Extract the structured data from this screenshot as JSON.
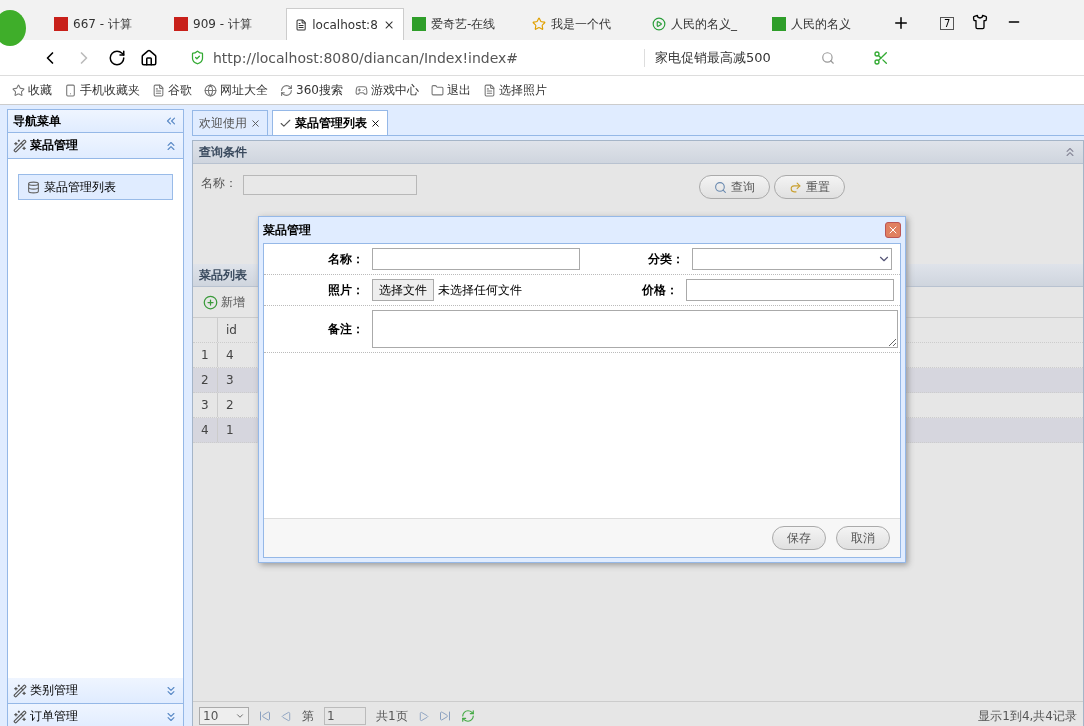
{
  "browser": {
    "tabs": [
      {
        "title": "667 - 计算",
        "selected": false,
        "kind": "red"
      },
      {
        "title": "909 - 计算",
        "selected": false,
        "kind": "red"
      },
      {
        "title": "localhost:8",
        "selected": true,
        "kind": "page"
      },
      {
        "title": "爱奇艺-在线",
        "selected": false,
        "kind": "green"
      },
      {
        "title": "我是一个代",
        "selected": false,
        "kind": "star"
      },
      {
        "title": "人民的名义_",
        "selected": false,
        "kind": "play"
      },
      {
        "title": "人民的名义",
        "selected": false,
        "kind": "green"
      }
    ],
    "tab_count": "7",
    "url_host": "http://localhost",
    "url_rest": ":8080/diancan/Index!index#",
    "search": "家电促销最高减500",
    "bookmarks": [
      "收藏",
      "手机收藏夹",
      "谷歌",
      "网址大全",
      "360搜索",
      "游戏中心",
      "退出",
      "选择照片"
    ]
  },
  "sidebar": {
    "title": "导航菜单",
    "panels": [
      {
        "title": "菜品管理",
        "expanded": true,
        "items": [
          {
            "label": "菜品管理列表",
            "selected": true
          }
        ]
      },
      {
        "title": "类别管理",
        "expanded": false
      },
      {
        "title": "订单管理",
        "expanded": false
      }
    ]
  },
  "content_tabs": [
    {
      "label": "欢迎使用",
      "selected": false
    },
    {
      "label": "菜品管理列表",
      "selected": true
    }
  ],
  "query": {
    "title": "查询条件",
    "name_label": "名称：",
    "buttons": [
      "查询",
      "重置"
    ]
  },
  "grid": {
    "title": "菜品列表",
    "add": "新增",
    "columns": [
      "id"
    ],
    "rows": [
      {
        "num": "1",
        "id": "4"
      },
      {
        "num": "2",
        "id": "3"
      },
      {
        "num": "3",
        "id": "2"
      },
      {
        "num": "4",
        "id": "1"
      }
    ]
  },
  "pager": {
    "page_size": "10",
    "page_prefix": "第",
    "page": "1",
    "total_pages": "共1页",
    "summary": "显示1到4,共4记录"
  },
  "dialog": {
    "title": "菜品管理",
    "name_label": "名称：",
    "category_label": "分类：",
    "photo_label": "照片：",
    "file_button": "选择文件",
    "file_status": "未选择任何文件",
    "price_label": "价格：",
    "remark_label": "备注：",
    "buttons": [
      "保存",
      "取消"
    ]
  }
}
